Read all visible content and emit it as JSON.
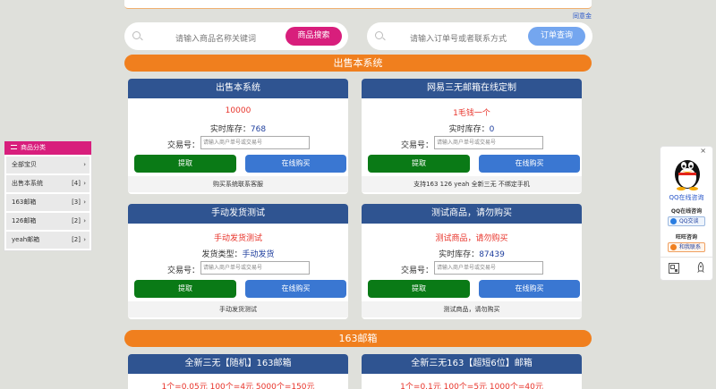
{
  "top": {
    "tongji_link": "同意金"
  },
  "search_product": {
    "placeholder": "请输入商品名称关键词",
    "button": "商品搜索"
  },
  "search_order": {
    "placeholder": "请输入订单号或者联系方式",
    "button": "订单查询"
  },
  "colors": {
    "accent_pink": "#d81e7c",
    "accent_blue": "#74a6ef",
    "orange": "#f07f1e",
    "navy": "#2f5491",
    "green": "#0a7a16"
  },
  "sections": [
    {
      "title": "出售本系统"
    },
    {
      "title": "163邮箱"
    }
  ],
  "cards": [
    {
      "title": "出售本系统",
      "price": "10000",
      "stock_label": "实时库存：",
      "stock_value": "768",
      "field_label": "交易号：",
      "input_placeholder": "请输入商户单号或交易号",
      "btn_extract": "提取",
      "btn_buy": "在线购买",
      "footer": "购买系统联系客服"
    },
    {
      "title": "网易三无邮箱在线定制",
      "price": "1毛钱一个",
      "stock_label": "实时库存：",
      "stock_value": "0",
      "field_label": "交易号：",
      "input_placeholder": "请输入商户单号或交易号",
      "btn_extract": "提取",
      "btn_buy": "在线购买",
      "footer": "支持163 126 yeah 全新三无 不绑定手机"
    },
    {
      "title": "手动发货测试",
      "price": "手动发货测试",
      "stock_label": "发货类型：",
      "stock_value": "手动发货",
      "field_label": "交易号：",
      "input_placeholder": "请输入商户单号或交易号",
      "btn_extract": "提取",
      "btn_buy": "在线购买",
      "footer": "手动发货测试"
    },
    {
      "title": "测试商品，请勿购买",
      "price": "测试商品，请勿购买",
      "stock_label": "实时库存：",
      "stock_value": "87439",
      "field_label": "交易号：",
      "input_placeholder": "请输入商户单号或交易号",
      "btn_extract": "提取",
      "btn_buy": "在线购买",
      "footer": "测试商品，请勿购买"
    },
    {
      "title": "全新三无【随机】163邮箱",
      "price": "1个=0.05元 100个=4元 5000个=150元"
    },
    {
      "title": "全新三无163【超短6位】邮箱",
      "price": "1个=0.1元 100个=5元 1000个=40元"
    }
  ],
  "sidebar": {
    "title": "商品分类",
    "items": [
      {
        "label": "全部宝贝",
        "count": ""
      },
      {
        "label": "出售本系统",
        "count": "[4]"
      },
      {
        "label": "163邮箱",
        "count": "[3]"
      },
      {
        "label": "126邮箱",
        "count": "[2]"
      },
      {
        "label": "yeah邮箱",
        "count": "[2]"
      }
    ]
  },
  "qq_widget": {
    "close": "×",
    "online_label": "QQ在线咨询",
    "qq_heading": "QQ在线咨询",
    "qq_chip": "QQ交谈",
    "ww_heading": "旺旺咨询",
    "ww_chip": "和我联系"
  }
}
